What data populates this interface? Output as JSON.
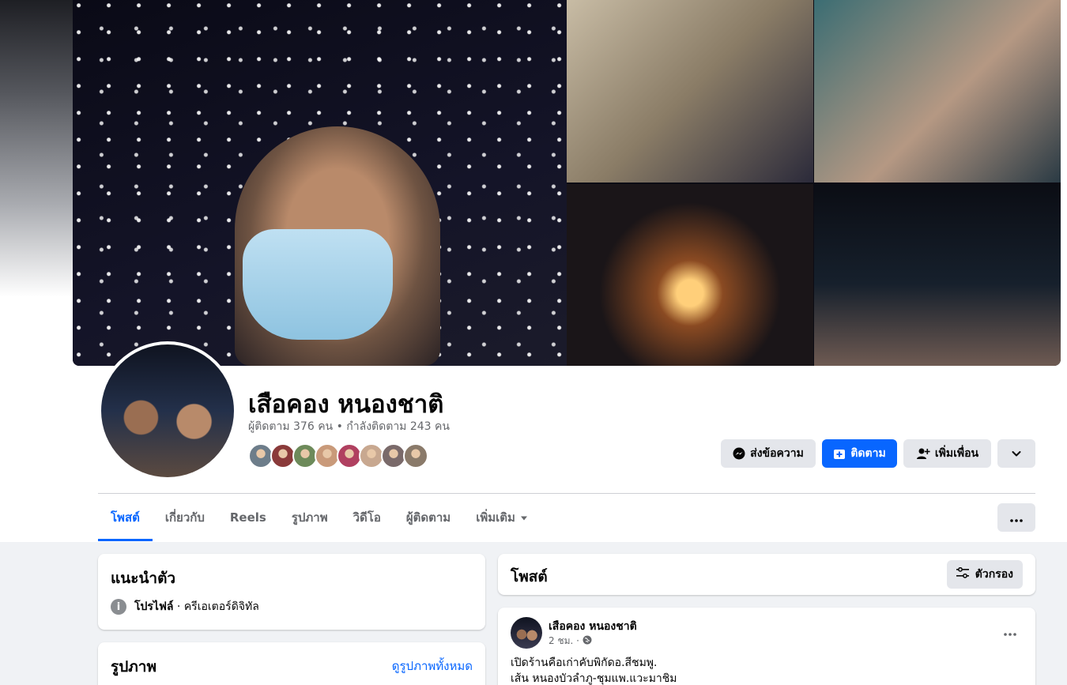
{
  "profile": {
    "name": "เสือคอง หนองชาติ",
    "follow_stats": "ผู้ติดตาม 376 คน • กำลังติดตาม 243 คน",
    "friend_avatars": [
      "#6d7d8a",
      "#8a3a3a",
      "#6d8a5a",
      "#c99a7a",
      "#b04060",
      "#c8a890",
      "#7a6a6a",
      "#8a7a6a"
    ]
  },
  "actions": {
    "message_label": "ส่งข้อความ",
    "follow_label": "ติดตาม",
    "add_friend_label": "เพิ่มเพื่อน"
  },
  "tabs": [
    {
      "label": "โพสต์"
    },
    {
      "label": "เกี่ยวกับ"
    },
    {
      "label": "Reels"
    },
    {
      "label": "รูปภาพ"
    },
    {
      "label": "วิดีโอ"
    },
    {
      "label": "ผู้ติดตาม"
    },
    {
      "label": "เพิ่มเติม"
    }
  ],
  "intro": {
    "title": "แนะนำตัว",
    "profile_label": "โปรไฟล์",
    "profile_desc": " · ครีเอเตอร์ดิจิทัล"
  },
  "photos": {
    "title": "รูปภาพ",
    "see_all": "ดูรูปภาพทั้งหมด"
  },
  "posts": {
    "title": "โพสต์",
    "filter_label": "ตัวกรอง"
  },
  "post": {
    "author": "เสือคอง หนองชาติ",
    "time": "2 ชม. ·",
    "line1": "เปิดร้านคือเก่าคับพิกัดอ.สีชมพู.",
    "line2": "เส้น หนองบัวลำภู-ชุมแพ.แวะมาชิม"
  },
  "colors": {
    "accent": "#0866ff",
    "secondary_button": "#e4e6eb",
    "page_bg": "#f0f2f5"
  }
}
